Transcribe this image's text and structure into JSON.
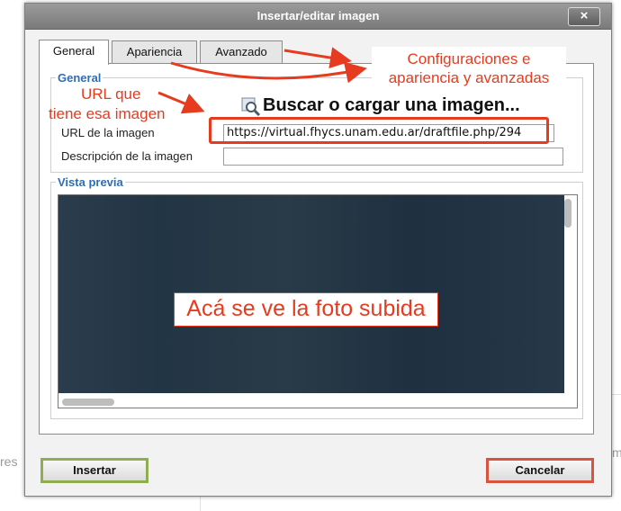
{
  "background": {
    "left_fragment": "res",
    "right_fragment": "m"
  },
  "dialog": {
    "title": "Insertar/editar imagen",
    "close_symbol": "×",
    "tabs": [
      {
        "label": "General",
        "active": true
      },
      {
        "label": "Apariencia",
        "active": false
      },
      {
        "label": "Avanzado",
        "active": false
      }
    ],
    "general": {
      "legend": "General",
      "browse_label": "Buscar o cargar una imagen...",
      "browse_icon": "magnifier-image-icon",
      "url_label": "URL de la imagen",
      "url_value": "https://virtual.fhycs.unam.edu.ar/draftfile.php/294",
      "description_label": "Descripción de la imagen",
      "description_value": ""
    },
    "preview": {
      "legend": "Vista previa"
    },
    "buttons": {
      "insert": "Insertar",
      "cancel": "Cancelar"
    }
  },
  "annotations": {
    "url_note_line1": "URL que",
    "url_note_line2": "tiene esa imagen",
    "tabs_note_line1": "Configuraciones e",
    "tabs_note_line2": "apariencia y avanzadas",
    "photo_note": "Acá se ve la foto subida"
  },
  "colors": {
    "annotation": "#e63b1f",
    "legend": "#2f6db5",
    "insert_border": "#8fae52",
    "cancel_border": "#d9543f"
  }
}
